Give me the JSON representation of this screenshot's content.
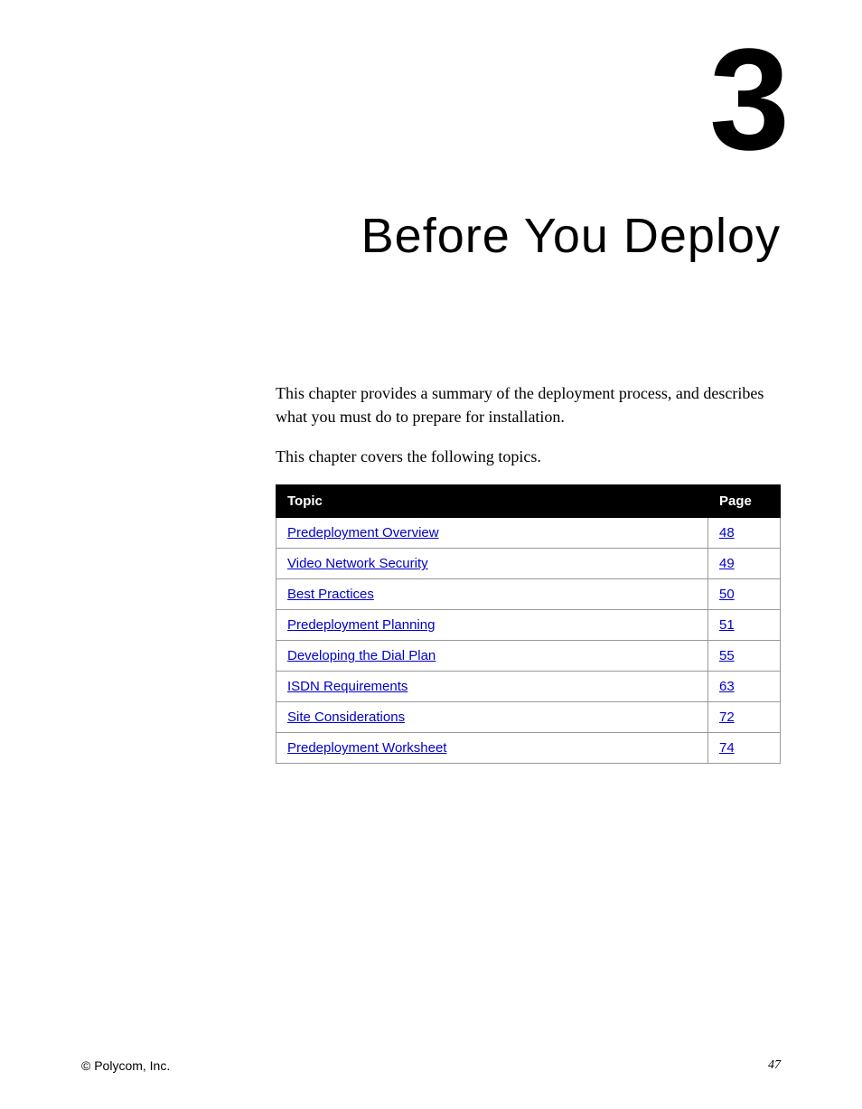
{
  "chapter": {
    "number": "3",
    "title": "Before You Deploy"
  },
  "intro": {
    "para1": "This chapter provides a summary of the deployment process, and describes what you must do to prepare for installation.",
    "para2": "This chapter covers the following topics."
  },
  "table": {
    "headers": {
      "topic": "Topic",
      "page": "Page"
    },
    "rows": [
      {
        "topic": "Predeployment Overview",
        "page": "48"
      },
      {
        "topic": "Video Network Security",
        "page": "49"
      },
      {
        "topic": "Best Practices",
        "page": "50"
      },
      {
        "topic": "Predeployment Planning",
        "page": "51"
      },
      {
        "topic": "Developing the Dial Plan",
        "page": "55"
      },
      {
        "topic": "ISDN Requirements",
        "page": "63"
      },
      {
        "topic": "Site Considerations",
        "page": "72"
      },
      {
        "topic": "Predeployment Worksheet",
        "page": "74"
      }
    ]
  },
  "footer": {
    "copyright": "© Polycom, Inc.",
    "page_number": "47"
  }
}
